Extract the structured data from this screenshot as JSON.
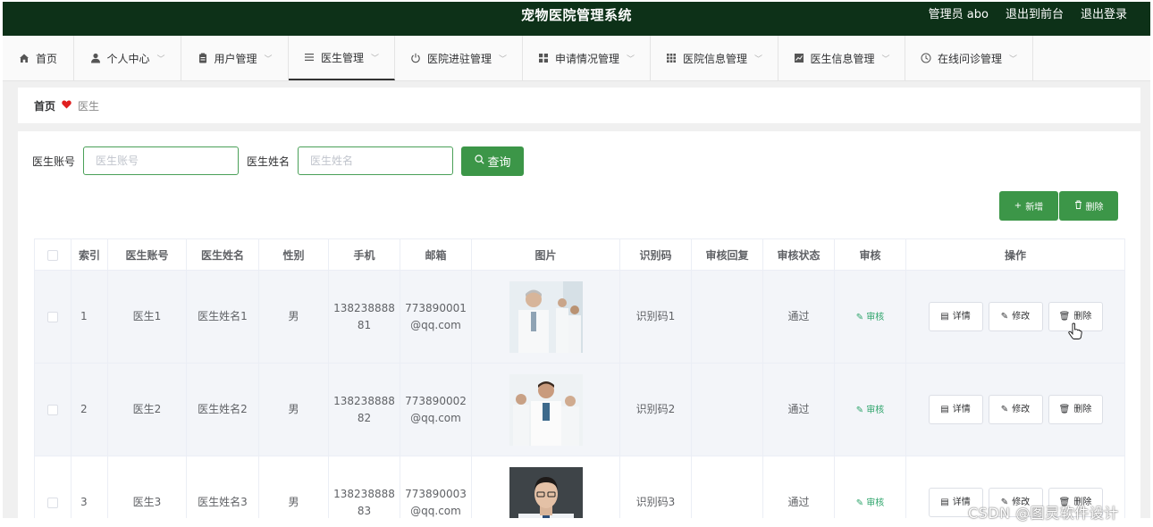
{
  "header": {
    "title": "宠物医院管理系统",
    "user": "管理员 abo",
    "to_front": "退出到前台",
    "logout": "退出登录"
  },
  "nav": [
    {
      "label": "首页",
      "icon": "home-icon",
      "dropdown": false
    },
    {
      "label": "个人中心",
      "icon": "user-icon",
      "dropdown": true
    },
    {
      "label": "用户管理",
      "icon": "clipboard-icon",
      "dropdown": true
    },
    {
      "label": "医生管理",
      "icon": "list-icon",
      "dropdown": true,
      "active": true
    },
    {
      "label": "医院进驻管理",
      "icon": "power-icon",
      "dropdown": true
    },
    {
      "label": "申请情况管理",
      "icon": "grid-icon",
      "dropdown": true
    },
    {
      "label": "医院信息管理",
      "icon": "grid9-icon",
      "dropdown": true
    },
    {
      "label": "医生信息管理",
      "icon": "chart-icon",
      "dropdown": true
    },
    {
      "label": "在线问诊管理",
      "icon": "clock-icon",
      "dropdown": true
    }
  ],
  "breadcrumb": {
    "home": "首页",
    "current": "医生"
  },
  "search": {
    "account_label": "医生账号",
    "account_placeholder": "医生账号",
    "name_label": "医生姓名",
    "name_placeholder": "医生姓名",
    "query_button": "查询"
  },
  "actions": {
    "add": "新增",
    "delete": "删除"
  },
  "table": {
    "columns": [
      "索引",
      "医生账号",
      "医生姓名",
      "性别",
      "手机",
      "邮箱",
      "图片",
      "识别码",
      "审核回复",
      "审核状态",
      "审核",
      "操作"
    ],
    "rows": [
      {
        "index": "1",
        "account": "医生1",
        "name": "医生姓名1",
        "gender": "男",
        "phone_a": "138238888",
        "phone_b": "81",
        "email_a": "773890001",
        "email_b": "@qq.com",
        "code": "识别码1",
        "reply": "",
        "status": "通过",
        "audit": "审核"
      },
      {
        "index": "2",
        "account": "医生2",
        "name": "医生姓名2",
        "gender": "男",
        "phone_a": "138238888",
        "phone_b": "82",
        "email_a": "773890002",
        "email_b": "@qq.com",
        "code": "识别码2",
        "reply": "",
        "status": "通过",
        "audit": "审核"
      },
      {
        "index": "3",
        "account": "医生3",
        "name": "医生姓名3",
        "gender": "男",
        "phone_a": "138238888",
        "phone_b": "83",
        "email_a": "773890003",
        "email_b": "@qq.com",
        "code": "识别码3",
        "reply": "",
        "status": "通过",
        "audit": "审核"
      }
    ],
    "op_labels": {
      "detail": "详情",
      "edit": "修改",
      "delete": "删除"
    }
  },
  "watermark": "CSDN @图灵软件设计",
  "colors": {
    "header_bg": "#0d3118",
    "accent": "#3c9648",
    "audit_green": "#2ea46b",
    "heart": "#e02020"
  }
}
